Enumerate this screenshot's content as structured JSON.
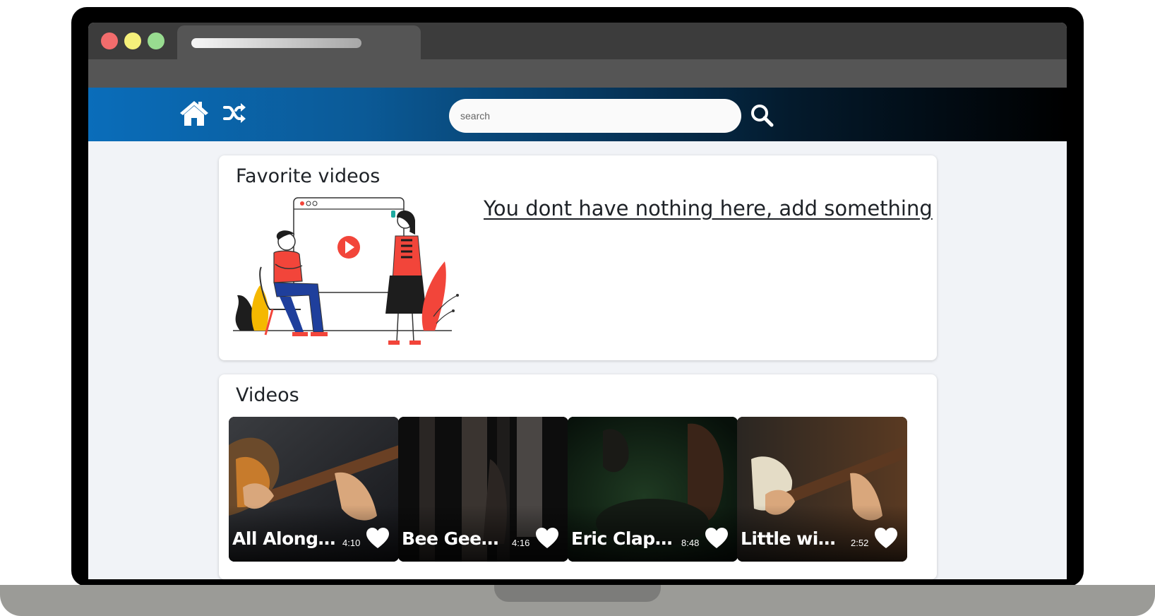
{
  "header": {
    "search": {
      "placeholder": "search",
      "value": ""
    },
    "icons": [
      "home-icon",
      "shuffle-icon",
      "search-icon"
    ]
  },
  "favorites": {
    "title": "Favorite videos",
    "empty_message": "You dont have nothing here, add something"
  },
  "videos": {
    "title": "Videos",
    "items": [
      {
        "title": "All Along ...",
        "duration": "4:10"
      },
      {
        "title": "Bee Gees ...",
        "duration": "4:16"
      },
      {
        "title": "Eric Clapt...",
        "duration": "8:48"
      },
      {
        "title": "Little win...",
        "duration": "2:52"
      }
    ]
  },
  "colors": {
    "header_start": "#0a6dba",
    "header_end": "#000000",
    "page_bg": "#f1f3f7",
    "accent_red": "#f2453a",
    "traffic_red": "#f26c6c",
    "traffic_yellow": "#f5f07a",
    "traffic_green": "#98dc90"
  }
}
